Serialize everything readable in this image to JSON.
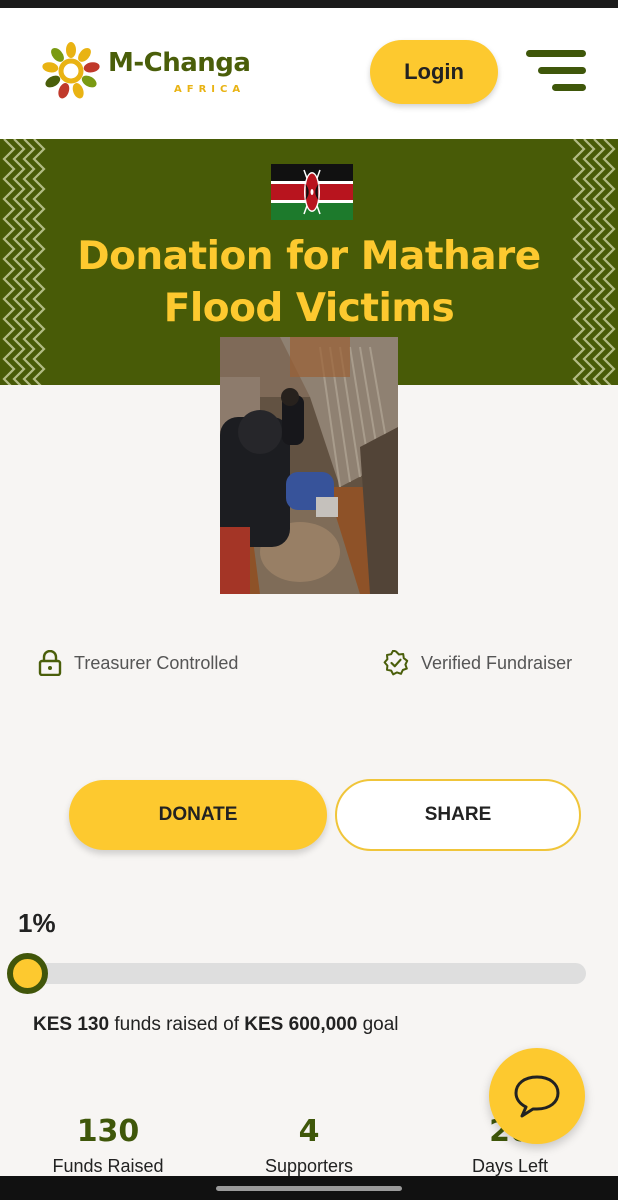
{
  "header": {
    "logo_name": "M-Changa",
    "logo_sub": "AFRICA",
    "login_label": "Login",
    "menu_icon": "hamburger-menu-icon"
  },
  "hero": {
    "flag_icon": "kenya-flag-icon",
    "title": "Donation for Mathare Flood Victims",
    "background_color": "#485b07",
    "title_color": "#fdc92f"
  },
  "badges": {
    "treasurer": "Treasurer Controlled",
    "verified": "Verified Fundraiser"
  },
  "actions": {
    "donate_label": "DONATE",
    "share_label": "SHARE"
  },
  "progress": {
    "percent_label": "1%",
    "fraction": 0.01,
    "raised_currency": "KES",
    "raised_amount": "130",
    "raised_text": "funds raised of",
    "goal_currency": "KES",
    "goal_amount": "600,000",
    "goal_text": "goal"
  },
  "stats": [
    {
      "value": "130",
      "label": "Funds Raised"
    },
    {
      "value": "4",
      "label": "Supporters"
    },
    {
      "value": "20",
      "label": "Days Left"
    }
  ],
  "colors": {
    "accent": "#fdc92f",
    "brand_green": "#3f570a"
  },
  "chat_icon": "chat-bubble-icon"
}
